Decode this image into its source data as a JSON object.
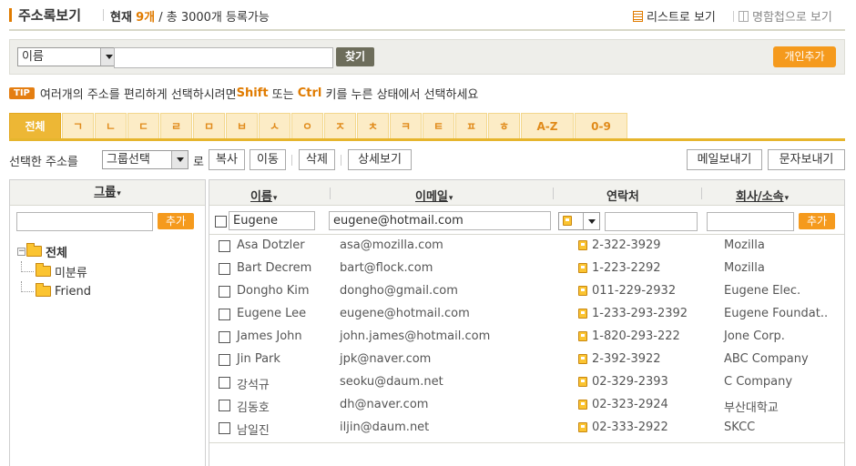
{
  "header": {
    "title": "주소록보기",
    "current_label": "현재",
    "current_count": "9개",
    "capacity_text": "/ 총 3000개 등록가능",
    "view_list": "리스트로 보기",
    "view_card": "명함첩으로 보기"
  },
  "search": {
    "field_selected": "이름",
    "query": "",
    "find_button": "찾기",
    "add_person_button": "개인추가"
  },
  "tip": {
    "badge": "TIP",
    "text_1": "여러개의 주소를 편리하게 선택하시려면 ",
    "key_1": "Shift",
    "text_2": " 또는 ",
    "key_2": "Ctrl",
    "text_3": " 키를 누른 상태에서 선택하세요"
  },
  "tabs": [
    "전체",
    "ㄱ",
    "ㄴ",
    "ㄷ",
    "ㄹ",
    "ㅁ",
    "ㅂ",
    "ㅅ",
    "ㅇ",
    "ㅈ",
    "ㅊ",
    "ㅋ",
    "ㅌ",
    "ㅍ",
    "ㅎ",
    "A-Z",
    "0-9"
  ],
  "actions": {
    "selected_label": "선택한 주소를",
    "group_select": "그룹선택",
    "ro": "로",
    "copy": "복사",
    "move": "이동",
    "delete": "삭제",
    "details": "상세보기",
    "send_mail": "메일보내기",
    "send_sms": "문자보내기"
  },
  "groups": {
    "header": "그룹",
    "add_button": "추가",
    "input_value": "",
    "items": [
      {
        "label": "전체"
      },
      {
        "label": "미분류"
      },
      {
        "label": "Friend"
      }
    ]
  },
  "table": {
    "headers": {
      "name": "이름",
      "email": "이메일",
      "phone": "연락처",
      "company": "회사/소속"
    },
    "new_row": {
      "name": "Eugene",
      "email": "eugene@hotmail.com",
      "phone": "",
      "company": "",
      "add_button": "추가"
    },
    "rows": [
      {
        "name": "Asa Dotzler",
        "email": "asa@mozilla.com",
        "phone": "2-322-3929",
        "company": "Mozilla"
      },
      {
        "name": "Bart Decrem",
        "email": "bart@flock.com",
        "phone": "1-223-2292",
        "company": "Mozilla"
      },
      {
        "name": "Dongho Kim",
        "email": "dongho@gmail.com",
        "phone": "011-229-2932",
        "company": "Eugene Elec."
      },
      {
        "name": "Eugene Lee",
        "email": "eugene@hotmail.com",
        "phone": "1-233-293-2392",
        "company": "Eugene Foundat.."
      },
      {
        "name": "James John",
        "email": "john.james@hotmail.com",
        "phone": "1-820-293-222",
        "company": "Jone Corp."
      },
      {
        "name": "Jin Park",
        "email": "jpk@naver.com",
        "phone": "2-392-3922",
        "company": "ABC Company"
      },
      {
        "name": "강석규",
        "email": "seoku@daum.net",
        "phone": "02-329-2393",
        "company": "C Company"
      },
      {
        "name": "김동호",
        "email": "dh@naver.com",
        "phone": "02-323-2924",
        "company": "부산대학교"
      },
      {
        "name": "남일진",
        "email": "iljin@daum.net",
        "phone": "02-333-2922",
        "company": "SKCC"
      }
    ]
  },
  "colors": {
    "accent_orange": "#f59a1d",
    "tab_active": "#edb735",
    "tab_inactive": "#fcecc6",
    "find_button": "#6d6d5b"
  }
}
